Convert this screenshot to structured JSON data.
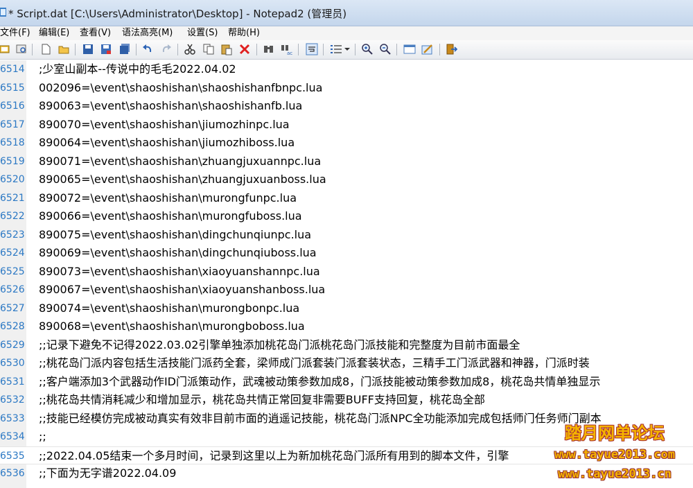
{
  "window": {
    "title": "* Script.dat [C:\\Users\\Administrator\\Desktop] - Notepad2 (管理员)"
  },
  "menu": [
    "文件(F)",
    "编辑(E)",
    "查看(V)",
    "语法高亮(M)",
    "设置(S)",
    "帮助(H)"
  ],
  "toolbar": {
    "icons": [
      "run-icon",
      "browse-icon",
      "new-file-icon",
      "open-folder-icon",
      "save-icon",
      "save-as-icon",
      "save-copy-icon",
      "undo-icon",
      "redo-icon",
      "cut-icon",
      "copy-icon",
      "paste-icon",
      "delete-icon",
      "find-icon",
      "replace-icon",
      "word-wrap-icon",
      "view-options-icon",
      "zoom-in-icon",
      "zoom-out-icon",
      "scheme-icon",
      "customize-icon",
      "exit-icon"
    ]
  },
  "colors": {
    "line_number": "#2b78c4",
    "gutter": "#f0f0f0",
    "watermark": "#f5b400"
  },
  "editor": {
    "lines": [
      {
        "num": "6514",
        "text": ";少室山副本--传说中的毛毛2022.04.02"
      },
      {
        "num": "6515",
        "text": "002096=\\event\\shaoshishan\\shaoshishanfbnpc.lua"
      },
      {
        "num": "6516",
        "text": "890063=\\event\\shaoshishan\\shaoshishanfb.lua"
      },
      {
        "num": "6517",
        "text": "890070=\\event\\shaoshishan\\jiumozhinpc.lua"
      },
      {
        "num": "6518",
        "text": "890064=\\event\\shaoshishan\\jiumozhiboss.lua"
      },
      {
        "num": "6519",
        "text": "890071=\\event\\shaoshishan\\zhuangjuxuannpc.lua"
      },
      {
        "num": "6520",
        "text": "890065=\\event\\shaoshishan\\zhuangjuxuanboss.lua"
      },
      {
        "num": "6521",
        "text": "890072=\\event\\shaoshishan\\murongfunpc.lua"
      },
      {
        "num": "6522",
        "text": "890066=\\event\\shaoshishan\\murongfuboss.lua"
      },
      {
        "num": "6523",
        "text": "890075=\\event\\shaoshishan\\dingchunqiunpc.lua"
      },
      {
        "num": "6524",
        "text": "890069=\\event\\shaoshishan\\dingchunqiuboss.lua"
      },
      {
        "num": "6525",
        "text": "890073=\\event\\shaoshishan\\xiaoyuanshannpc.lua"
      },
      {
        "num": "6526",
        "text": "890067=\\event\\shaoshishan\\xiaoyuanshanboss.lua"
      },
      {
        "num": "6527",
        "text": "890074=\\event\\shaoshishan\\murongbonpc.lua"
      },
      {
        "num": "6528",
        "text": "890068=\\event\\shaoshishan\\murongboboss.lua"
      },
      {
        "num": "6529",
        "text": ";;记录下避免不记得2022.03.02引擎单独添加桃花岛门派桃花岛门派技能和完整度为目前市面最全"
      },
      {
        "num": "6530",
        "text": ";;桃花岛门派内容包括生活技能门派药全套，梁师成门派套装门派套装状态，三精手工门派武器和神器，门派时装"
      },
      {
        "num": "6531",
        "text": ";;客户端添加3个武器动作ID门派策动作，武魂被动策参数加成8，门派技能被动策参数加成8，桃花岛共情单独显示"
      },
      {
        "num": "6532",
        "text": ";;桃花岛共情消耗减少和增加显示，桃花岛共情正常回复非需要BUFF支持回复，桃花岛全部"
      },
      {
        "num": "6533",
        "text": ";;技能已经模仿完成被动真实有效非目前市面的逍遥记技能，桃花岛门派NPC全功能添加完成包括师门任务师门副本"
      },
      {
        "num": "6534",
        "text": ";;"
      },
      {
        "num": "6535",
        "text": ";;2022.04.05结束一个多月时间，记录到这里以上为新加桃花岛门派所有用到的脚本文件，引擎"
      },
      {
        "num": "6536",
        "text": ";;下面为无字谱2022.04.09"
      }
    ]
  },
  "watermark": {
    "name": "踏月网单论坛",
    "url1": "www.tayue2013.com",
    "url2": "www.tayue2013.cn"
  }
}
